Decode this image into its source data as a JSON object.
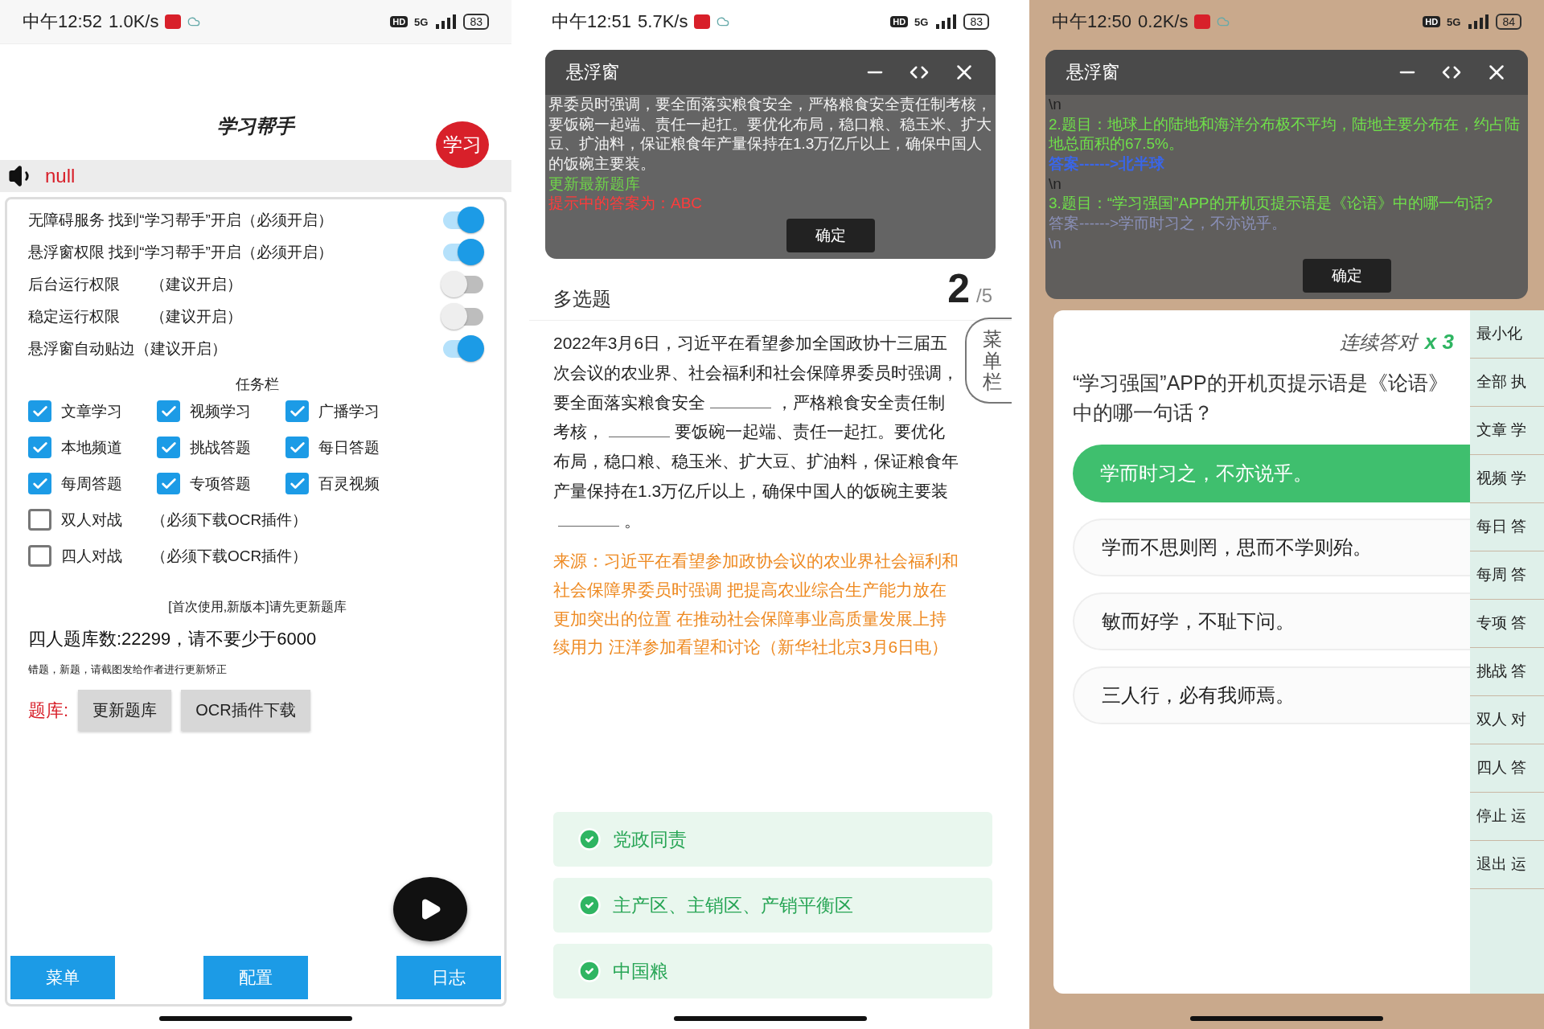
{
  "helper_screen": {
    "status_bar": {
      "time": "中午12:52",
      "speed": "1.0K/s",
      "hd": "HD",
      "signal": "5G",
      "battery": "83"
    },
    "title": "学习帮手",
    "logo": "学习",
    "sound_text": "null",
    "permissions": [
      {
        "label": "无障碍服务 找到“学习帮手”开启（必须开启）",
        "on": true
      },
      {
        "label": "悬浮窗权限 找到“学习帮手”开启（必须开启）",
        "on": true
      },
      {
        "label": "后台运行权限　　（建议开启）",
        "on": false
      },
      {
        "label": "稳定运行权限　　（建议开启）",
        "on": false
      },
      {
        "label": "悬浮窗自动贴边（建议开启）",
        "on": true
      }
    ],
    "taskbar_title": "任务栏",
    "tasks": [
      {
        "label": "文章学习",
        "checked": true
      },
      {
        "label": "视频学习",
        "checked": true
      },
      {
        "label": "广播学习",
        "checked": true
      },
      {
        "label": "本地频道",
        "checked": true
      },
      {
        "label": "挑战答题",
        "checked": true
      },
      {
        "label": "每日答题",
        "checked": true
      },
      {
        "label": "每周答题",
        "checked": true
      },
      {
        "label": "专项答题",
        "checked": true
      },
      {
        "label": "百灵视频",
        "checked": true
      }
    ],
    "battle_tasks": [
      {
        "label": "双人对战",
        "note": "（必须下载OCR插件）",
        "checked": false
      },
      {
        "label": "四人对战",
        "note": "（必须下载OCR插件）",
        "checked": false
      }
    ],
    "update_notice": "[首次使用,新版本]请先更新题库",
    "bank_count": "四人题库数:22299，请不要少于6000",
    "feedback": "错题，新题，请截图发给作者进行更新矫正",
    "bank_label": "题库:",
    "bank_buttons": [
      "更新题库",
      "OCR插件下载"
    ],
    "bottom_buttons": [
      "菜单",
      "配置",
      "日志"
    ]
  },
  "fill_blank_screen": {
    "status_bar": {
      "time": "中午12:51",
      "speed": "5.7K/s",
      "hd": "HD",
      "signal": "5G",
      "battery": "83"
    },
    "float_window": {
      "title": "悬浮窗",
      "lines": [
        {
          "kind": "text",
          "text": "界委员时强调，要全面落实粮食安全，严格粮食安全责任制考核，要饭碗一起端、责任一起扛。要优化布局，稳口粮、稳玉米、扩大豆、扩油料，保证粮食年产量保持在1.3万亿斤以上，确保中国人的饭碗主要装。"
        },
        {
          "kind": "update",
          "text": "更新最新题库"
        },
        {
          "kind": "hint",
          "text": "提示中的答案为：ABC"
        }
      ],
      "confirm": "确定"
    },
    "question_type": "多选题",
    "number": "2",
    "total": "/5",
    "menu_tab": "菜单栏",
    "question": [
      {
        "kind": "text",
        "text": "2022年3月6日，习近平在看望参加全国政协十三届五次会议的农业界、社会福利和社会保障界委员时强调，要全面落实粮食安全"
      },
      {
        "kind": "blank"
      },
      {
        "kind": "text",
        "text": "，严格粮食安全责任制考核，"
      },
      {
        "kind": "blank"
      },
      {
        "kind": "text",
        "text": "要饭碗一起端、责任一起扛。要优化布局，稳口粮、稳玉米、扩大豆、扩油料，保证粮食年产量保持在1.3万亿斤以上，确保中国人的饭碗主要装"
      },
      {
        "kind": "blank"
      },
      {
        "kind": "text",
        "text": "。"
      }
    ],
    "source": "来源：习近平在看望参加政协会议的农业界社会福利和社会保障界委员时强调 把提高农业综合生产能力放在更加突出的位置 在推动社会保障事业高质量发展上持续用力 汪洋参加看望和讨论（新华社北京3月6日电）",
    "options": [
      {
        "text": "党政同责",
        "checked": true
      },
      {
        "text": "主产区、主销区、产销平衡区",
        "checked": true
      },
      {
        "text": "中国粮",
        "checked": true
      }
    ]
  },
  "choice_screen": {
    "status_bar": {
      "time": "中午12:50",
      "speed": "0.2K/s",
      "hd": "HD",
      "signal": "5G",
      "battery": "84"
    },
    "float_window": {
      "title": "悬浮窗",
      "lines": [
        {
          "kind": "marker",
          "text": "\\n"
        },
        {
          "kind": "question",
          "text": "2.题目：地球上的陆地和海洋分布极不平均，陆地主要分布在，约占陆地总面积的67.5%。"
        },
        {
          "kind": "answer",
          "text": "答案------>北半球"
        },
        {
          "kind": "marker",
          "text": "\\n"
        },
        {
          "kind": "question",
          "text": "3.题目：“学习强国”APP的开机页提示语是《论语》中的哪一句话?"
        },
        {
          "kind": "faded",
          "text": "答案------>学而时习之，不亦说乎。"
        },
        {
          "kind": "faded",
          "text": "\\n"
        }
      ],
      "confirm": "确定"
    },
    "streak_label": "连续答对",
    "streak_count": "x 3",
    "question": "“学习强国”APP的开机页提示语是《论语》中的哪一句话？",
    "options": [
      {
        "text": "学而时习之，不亦说乎。",
        "selected": true
      },
      {
        "text": "学而不思则罔，思而不学则殆。",
        "selected": false
      },
      {
        "text": "敏而好学，不耻下问。",
        "selected": false
      },
      {
        "text": "三人行，必有我师焉。",
        "selected": false
      }
    ],
    "side_menu": [
      "最小化",
      "全部 执",
      "文章 学",
      "视频 学",
      "每日 答",
      "每周 答",
      "专项 答",
      "挑战 答",
      "双人 对",
      "四人 答",
      "停止 运",
      "退出 运"
    ]
  }
}
